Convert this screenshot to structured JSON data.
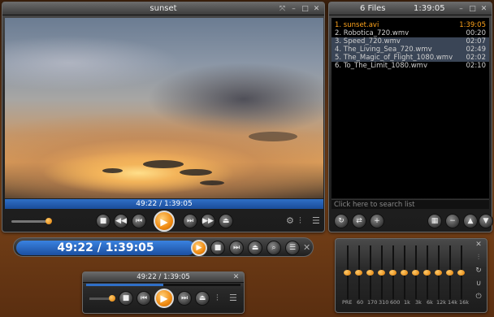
{
  "main_player": {
    "title": "sunset",
    "time_display": "49:22 / 1:39:05"
  },
  "playlist": {
    "title": "6 Files",
    "total_time": "1:39:05",
    "items": [
      {
        "name": "1. sunset.avi",
        "duration": "1:39:05"
      },
      {
        "name": "2. Robotica_720.wmv",
        "duration": "00:20"
      },
      {
        "name": "3. Speed_720.wmv",
        "duration": "02:07"
      },
      {
        "name": "4. The_Living_Sea_720.wmv",
        "duration": "02:49"
      },
      {
        "name": "5. The_Magic_of_Flight_1080.wmv",
        "duration": "02:02"
      },
      {
        "name": "6. To_The_Limit_1080.wmv",
        "duration": "02:10"
      }
    ],
    "search_placeholder": "Click here to search list"
  },
  "minibar": {
    "time_display": "49:22 / 1:39:05"
  },
  "compact_player": {
    "time_display": "49:22 / 1:39:05"
  },
  "equalizer": {
    "bands": [
      {
        "label": "PRE",
        "value": 0.5
      },
      {
        "label": "60",
        "value": 0.5
      },
      {
        "label": "170",
        "value": 0.5
      },
      {
        "label": "310",
        "value": 0.5
      },
      {
        "label": "600",
        "value": 0.5
      },
      {
        "label": "1k",
        "value": 0.5
      },
      {
        "label": "3k",
        "value": 0.5
      },
      {
        "label": "6k",
        "value": 0.5
      },
      {
        "label": "12k",
        "value": 0.5
      },
      {
        "label": "14k",
        "value": 0.5
      },
      {
        "label": "16k",
        "value": 0.5
      }
    ]
  },
  "progress": {
    "playback_fraction": 0.498,
    "volume_fraction": 0.9
  },
  "colors": {
    "accent": "#ffa41c",
    "seek_blue": "#2f6fc7",
    "background": "#6a3a17"
  },
  "icons": [
    "stop-icon",
    "prev-icon",
    "rewind-icon",
    "play-icon",
    "forward-icon",
    "next-icon",
    "open-icon",
    "equalizer-icon",
    "menu-icon",
    "close-icon",
    "fullscreen-icon",
    "minimize-icon",
    "maximize-icon",
    "search-icon",
    "settings-icon"
  ]
}
